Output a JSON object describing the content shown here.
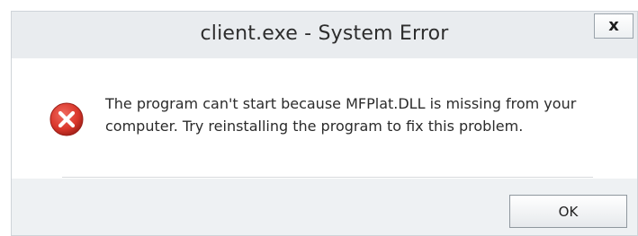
{
  "window": {
    "title": "client.exe - System Error",
    "close_label": "x"
  },
  "message": {
    "text": "The program can't start because MFPlat.DLL is missing from your computer. Try reinstalling the program to fix this problem.",
    "icon": "error-icon"
  },
  "buttons": {
    "ok_label": "OK"
  },
  "colors": {
    "error_red": "#d9362b",
    "title_bar": "#e9ecef",
    "content_bg": "#ffffff"
  }
}
